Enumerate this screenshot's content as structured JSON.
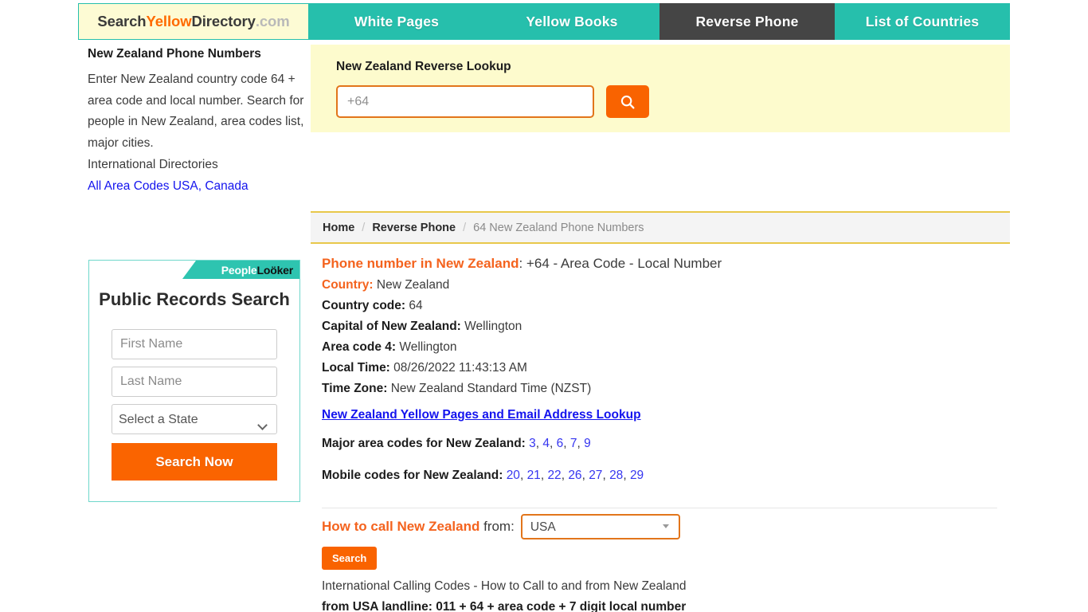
{
  "header": {
    "logo": {
      "part1": "Search",
      "part2": "Yellow",
      "part3": "Directory",
      "part4": ".com"
    },
    "tabs": [
      {
        "label": "White Pages",
        "active": false
      },
      {
        "label": "Yellow Books",
        "active": false
      },
      {
        "label": "Reverse Phone",
        "active": true
      },
      {
        "label": "List of Countries",
        "active": false
      }
    ]
  },
  "sidebar": {
    "title": "New Zealand Phone Numbers",
    "paragraph": "Enter New Zealand country code 64 + area code and local number. Search for people in New Zealand, area codes list, major cities.",
    "subtitle": "International Directories",
    "link": "All Area Codes USA, Canada"
  },
  "widget": {
    "brand_people": "People",
    "brand_looker": "Loöker",
    "heading": "Public Records Search",
    "first_name_placeholder": "First Name",
    "first_name_value": "",
    "last_name_placeholder": "Last Name",
    "last_name_value": "",
    "state_selected": "Select a State",
    "button_label": "Search Now"
  },
  "search_panel": {
    "title": "New Zealand Reverse Lookup",
    "input_placeholder": "+64",
    "input_value": "",
    "button_icon": "search-icon"
  },
  "breadcrumb": {
    "home": "Home",
    "section": "Reverse Phone",
    "current": "64 New Zealand Phone Numbers",
    "separator": "/"
  },
  "details": {
    "headline_accent": "Phone number in New Zealand",
    "headline_rest": ": +64 - Area Code - Local Number",
    "rows": [
      {
        "label": "Country:",
        "value": "New Zealand",
        "accent": true
      },
      {
        "label": "Country code:",
        "value": "64",
        "accent": false
      },
      {
        "label": "Capital of New Zealand:",
        "value": "Wellington",
        "accent": false
      },
      {
        "label": "Area code 4:",
        "value": "Wellington",
        "accent": false
      },
      {
        "label": "Local Time:",
        "value": "08/26/2022 11:43:13 AM",
        "accent": false
      },
      {
        "label": "Time Zone:",
        "value": "New Zealand Standard Time (NZST)",
        "accent": false
      }
    ],
    "yellow_pages_link": "New Zealand Yellow Pages and Email Address Lookup",
    "major_codes_label": "Major area codes for New Zealand:",
    "major_codes": [
      "3",
      "4",
      "6",
      "7",
      "9"
    ],
    "mobile_codes_label": "Mobile codes for New Zealand:",
    "mobile_codes": [
      "20",
      "21",
      "22",
      "26",
      "27",
      "28",
      "29"
    ]
  },
  "howto": {
    "accent": "How to call New Zealand",
    "rest": " from:",
    "country_selected": "USA",
    "search_label": "Search",
    "note": "International Calling Codes - How to Call to and from New Zealand",
    "note2": "from USA landline: 011 + 64 + area code + 7 digit local number"
  },
  "colors": {
    "teal": "#26bfac",
    "orange": "#f96300",
    "accent_orange": "#f4631e",
    "link_blue": "#1414ee",
    "panel_yellow": "#fdfbcd",
    "active_tab": "#454545"
  }
}
